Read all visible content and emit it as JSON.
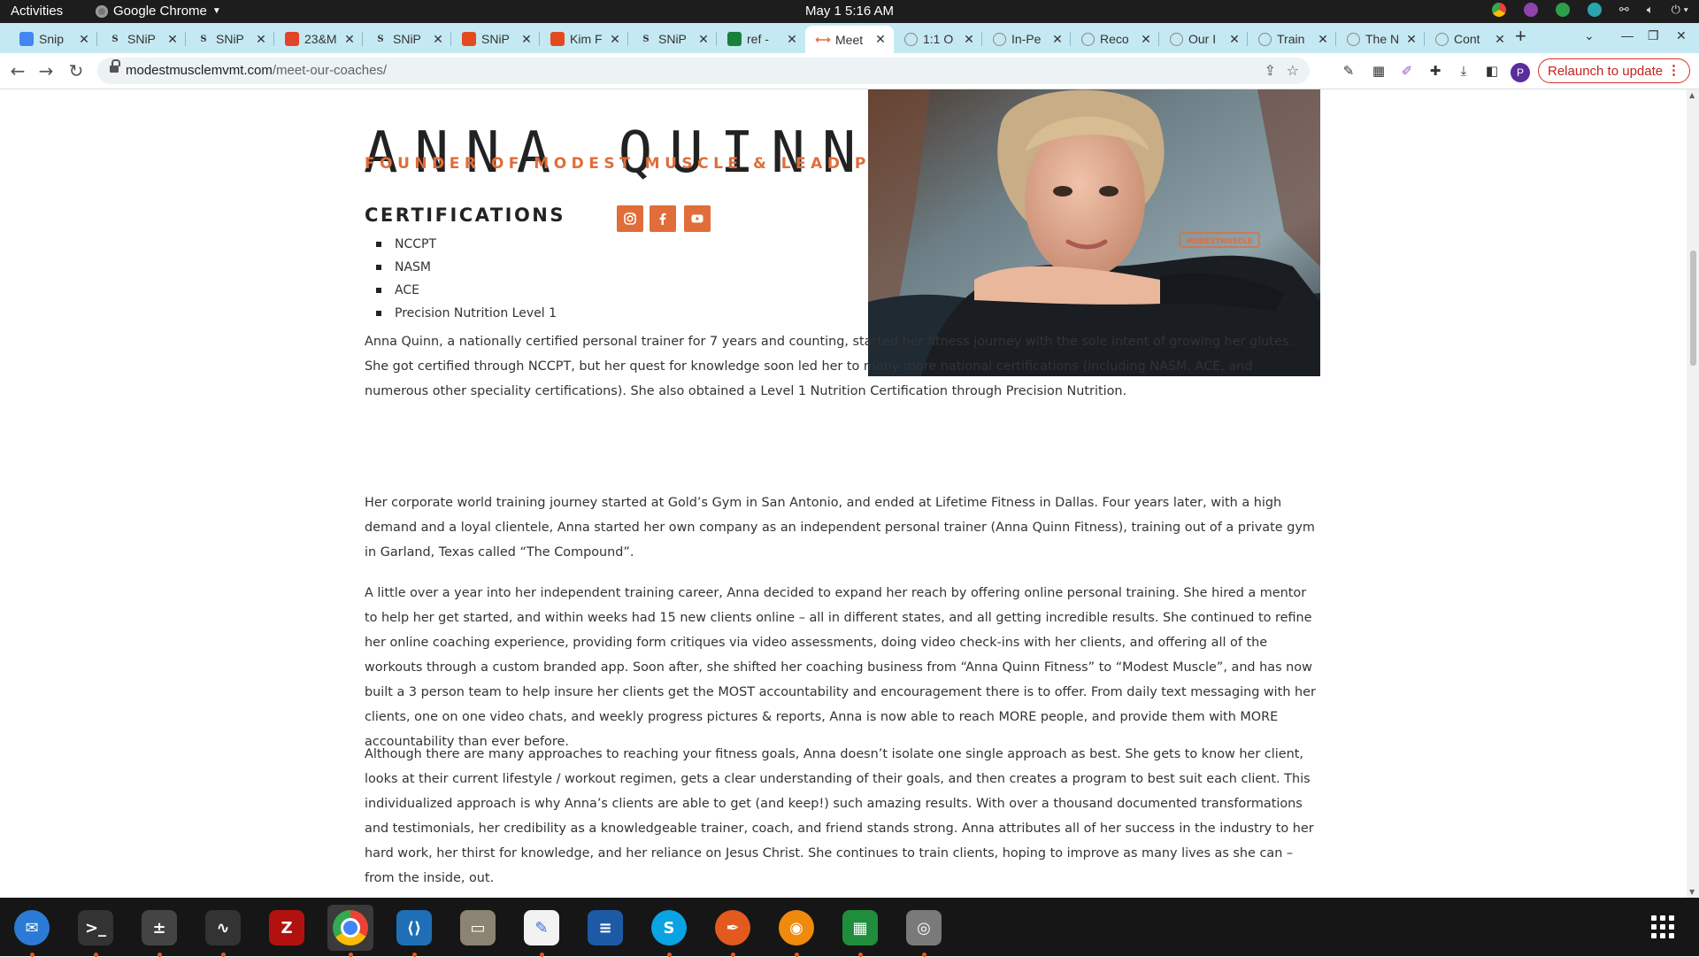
{
  "topbar": {
    "activities": "Activities",
    "app_name": "Google Chrome",
    "clock": "May 1  5:16 AM"
  },
  "tabs": [
    {
      "title": "Snip",
      "icon": "docs-icon",
      "color": "#4285f4"
    },
    {
      "title": "SNiP",
      "icon": "snip-logo-icon",
      "color": "#333333"
    },
    {
      "title": "SNiP",
      "icon": "snip-logo-icon",
      "color": "#333333"
    },
    {
      "title": "23&M",
      "icon": "gitlab-icon",
      "color": "#e24329"
    },
    {
      "title": "SNiP",
      "icon": "snip-logo-icon",
      "color": "#333333"
    },
    {
      "title": "SNiP",
      "icon": "snip-red-icon",
      "color": "#e34b1f"
    },
    {
      "title": "Kim F",
      "icon": "snip-red-icon",
      "color": "#e34b1f"
    },
    {
      "title": "SNiP",
      "icon": "snip-logo-icon",
      "color": "#333333"
    },
    {
      "title": "ref -",
      "icon": "sheets-icon",
      "color": "#188038"
    },
    {
      "title": "Meet",
      "icon": "site-icon",
      "color": "#e06d3a",
      "active": true
    },
    {
      "title": "1:1 O",
      "icon": "globe-icon",
      "color": "#888888"
    },
    {
      "title": "In-Pe",
      "icon": "globe-icon",
      "color": "#888888"
    },
    {
      "title": "Reco",
      "icon": "globe-icon",
      "color": "#888888"
    },
    {
      "title": "Our I",
      "icon": "globe-icon",
      "color": "#888888"
    },
    {
      "title": "Train",
      "icon": "globe-icon",
      "color": "#888888"
    },
    {
      "title": "The N",
      "icon": "globe-icon",
      "color": "#888888"
    },
    {
      "title": "Cont",
      "icon": "globe-icon",
      "color": "#888888"
    }
  ],
  "omnibox": {
    "domain": "modestmusclemvmt.com",
    "path": "/meet-our-coaches/"
  },
  "profile_initial": "P",
  "relaunch_label": "Relaunch to update",
  "coach": {
    "name": "ANNA QUINN",
    "role": "FOUNDER OF MODEST MUSCLE & LEAD PT",
    "certifications_heading": "CERTIFICATIONS",
    "certifications": [
      "NCCPT",
      "NASM",
      "ACE",
      "Precision Nutrition Level 1"
    ],
    "photo_logo_text": "MODESTMUSCLE",
    "bio": [
      "Anna Quinn, a nationally certified personal trainer for 7 years and counting, started her fitness journey with the sole intent of growing her glutes. She got certified through NCCPT, but her quest for knowledge soon led her to many more national certifications (including NASM, ACE, and numerous other speciality certifications). She also obtained a Level 1 Nutrition Certification through Precision Nutrition.",
      "Her corporate world training journey started at Gold’s Gym in San Antonio, and ended at Lifetime Fitness in Dallas. Four years later, with a high demand and a loyal clientele, Anna started her own company as an independent personal trainer (Anna Quinn Fitness), training out of a private gym in Garland, Texas called “The Compound”.",
      "A little over a year into her independent training career, Anna decided to expand her reach by offering online personal training. She hired a mentor to help her get started, and within weeks had 15 new clients online – all in different states, and all getting incredible results. She continued to refine her online coaching experience, providing form critiques via video assessments, doing video check-ins with her clients, and offering all of the workouts through a custom branded app. Soon after, she shifted her coaching business from “Anna Quinn Fitness” to “Modest Muscle”, and has now built a 3 person team to help insure her clients get the MOST accountability and encouragement there is to offer. From daily text messaging with her clients, one on one video chats, and weekly progress pictures & reports, Anna is now able to reach MORE people, and provide them with MORE accountability than ever before.",
      "Although there are many approaches to reaching your fitness goals, Anna doesn’t isolate one single approach as best. She gets to know her client, looks at their current lifestyle / workout regimen, gets a clear understanding of their goals, and then creates a program to best suit each client. This individualized approach is why Anna’s clients are able to get (and keep!) such amazing results. With over a thousand documented transformations and testimonials, her credibility as a knowledgeable trainer, coach, and friend stands strong. Anna attributes all of her success in the industry to her hard work, her thirst for knowledge, and her reliance on Jesus Christ. She continues to train clients, hoping to improve as many lives as she can – from the inside, out."
    ]
  },
  "social": [
    "instagram-icon",
    "facebook-icon",
    "youtube-icon"
  ],
  "colors": {
    "accent": "#e06d3a",
    "tabstrip": "#c5e9f2",
    "relaunch": "#d93025"
  },
  "dock": [
    {
      "name": "thunderbird-icon",
      "running": false
    },
    {
      "name": "terminal-icon",
      "running": false
    },
    {
      "name": "calculator-icon",
      "running": false
    },
    {
      "name": "system-monitor-icon",
      "running": false
    },
    {
      "name": "filezilla-icon",
      "running": false
    },
    {
      "name": "chrome-icon",
      "running": true
    },
    {
      "name": "vscode-icon",
      "running": false
    },
    {
      "name": "files-icon",
      "running": false
    },
    {
      "name": "text-editor-icon",
      "running": false
    },
    {
      "name": "writer-icon",
      "running": false
    },
    {
      "name": "skype-icon",
      "running": false
    },
    {
      "name": "inkscape-icon",
      "running": false
    },
    {
      "name": "blender-icon",
      "running": false
    },
    {
      "name": "calc-sheets-icon",
      "running": false
    },
    {
      "name": "disk-icon",
      "running": false
    }
  ]
}
